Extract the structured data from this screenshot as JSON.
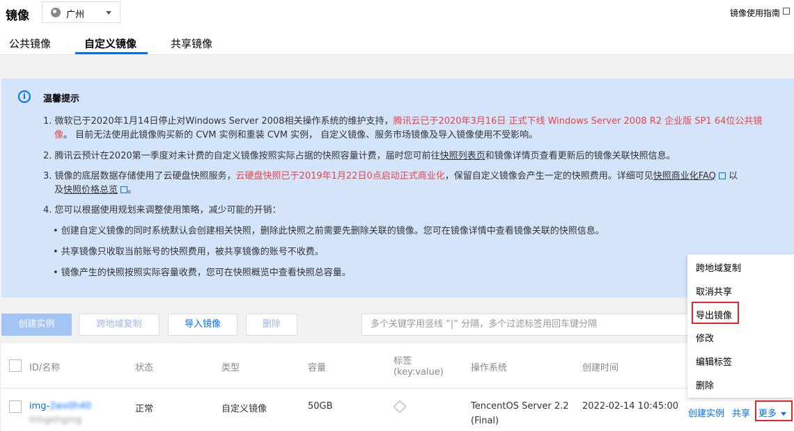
{
  "header": {
    "title": "镜像",
    "region": "广州",
    "guide_link": "镜像使用指南"
  },
  "tabs": [
    {
      "label": "公共镜像",
      "active": false
    },
    {
      "label": "自定义镜像",
      "active": true
    },
    {
      "label": "共享镜像",
      "active": false
    }
  ],
  "notice": {
    "title": "温馨提示",
    "l1a": "1. 微软已于2020年1月14日停止对Windows Server 2008相关操作系统的维护支持，",
    "l1b": "腾讯云已于2020年3月16日 正式下线 Windows Server 2008 R2 企业版 SP1 64位公共镜",
    "l1c": "像",
    "l1d": "。 目前无法使用此镜像购买新的 CVM 实例和重装 CVM 实例， 自定义镜像、服务市场镜像及导入镜像使用不受影响。",
    "l2a": "2. 腾讯云预计在2020第一季度对未计费的自定义镜像按照实际占据的快照容量计费，届时您可前往",
    "l2link": "快照列表页",
    "l2b": "和镜像详情页查看更新后的镜像关联快照信息。",
    "l3a": "3. 镜像的底层数据存储使用了云硬盘快照服务，",
    "l3red": "云硬盘快照已于2019年1月22日0点启动正式商业化",
    "l3b": "，保留自定义镜像会产生一定的快照费用。详细可见",
    "l3link": "快照商业化FAQ",
    "l3c": "以",
    "l3d": "及",
    "l3link2": "快照价格总览",
    "l3e": "。",
    "l4": "4. 您可以根据使用规划来调整使用策略，减少可能的开销：",
    "b1": "• 创建自定义镜像的同时系统默认会创建相关快照，删除此快照之前需要先删除关联的镜像。您可在镜像详情中查看镜像关联的快照信息。",
    "b2": "• 共享镜像只收取当前账号的快照费用，被共享镜像的账号不收费。",
    "b3": "• 镜像产生的快照按照实际容量收费，您可在快照概览中查看快照总容量。"
  },
  "toolbar": {
    "create": "创建实例",
    "cross_copy": "跨地域复制",
    "import": "导入镜像",
    "delete": "删除",
    "search_placeholder": "多个关键字用竖线 “|” 分隔，多个过滤标签用回车键分隔"
  },
  "table": {
    "headers": {
      "id": "ID/名称",
      "status": "状态",
      "type": "类型",
      "capacity": "容量",
      "tag": "标签",
      "tag_sub": "(key:value)",
      "os": "操作系统",
      "created": "创建时间"
    },
    "row": {
      "id_prefix": "img-",
      "id_blur": "2wx0h40",
      "name_blur": "thhgehgmg",
      "status": "正常",
      "type": "自定义镜像",
      "capacity": "50GB",
      "os_line1": "TencentOS Server 2.2",
      "os_line2": "(Final)",
      "created": "2022-02-14 10:45:00",
      "op_create": "创建实例",
      "op_share": "共享",
      "op_more": "更多"
    }
  },
  "menu": {
    "items": [
      "跨地域复制",
      "取消共享",
      "导出镜像",
      "修改",
      "编辑标签",
      "删除"
    ]
  },
  "colors": {
    "accent": "#006eff",
    "highlight": "#e5252b",
    "notice_bg": "#d4e4fb",
    "danger_text": "#e54545"
  }
}
